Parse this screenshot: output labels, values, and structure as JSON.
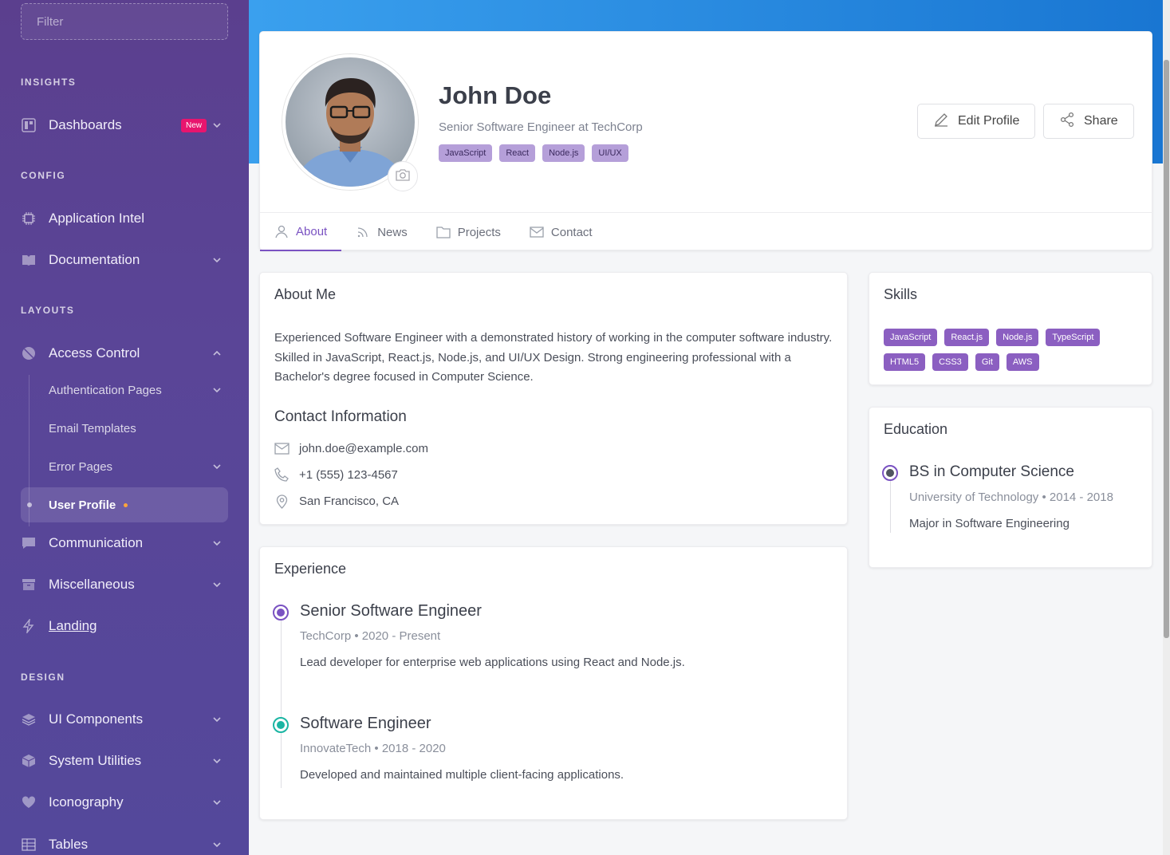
{
  "sidebar": {
    "filter_placeholder": "Filter",
    "sections": {
      "insights": "INSIGHTS",
      "config": "CONFIG",
      "layouts": "LAYOUTS",
      "design": "DESIGN"
    },
    "items": {
      "dashboards": "Dashboards",
      "dashboards_badge": "New",
      "application_intel": "Application Intel",
      "documentation": "Documentation",
      "access_control": "Access Control",
      "authentication_pages": "Authentication Pages",
      "email_templates": "Email Templates",
      "error_pages": "Error Pages",
      "user_profile": "User Profile",
      "communication": "Communication",
      "miscellaneous": "Miscellaneous",
      "landing": "Landing",
      "ui_components": "UI Components",
      "system_utilities": "System Utilities",
      "iconography": "Iconography",
      "tables": "Tables"
    }
  },
  "profile": {
    "name": "John Doe",
    "role": "Senior Software Engineer at TechCorp",
    "tags": [
      "JavaScript",
      "React",
      "Node.js",
      "UI/UX"
    ],
    "edit_label": "Edit Profile",
    "share_label": "Share"
  },
  "tabs": [
    "About",
    "News",
    "Projects",
    "Contact"
  ],
  "about": {
    "title": "About Me",
    "text": "Experienced Software Engineer with a demonstrated history of working in the computer software industry. Skilled in JavaScript, React.js, Node.js, and UI/UX Design. Strong engineering professional with a Bachelor's degree focused in Computer Science.",
    "contact_title": "Contact Information",
    "email": "john.doe@example.com",
    "phone": "+1 (555) 123-4567",
    "location": "San Francisco, CA"
  },
  "experience": {
    "title": "Experience",
    "jobs": [
      {
        "title": "Senior Software Engineer",
        "sub": "TechCorp • 2020 - Present",
        "desc": "Lead developer for enterprise web applications using React and Node.js.",
        "color": "#7a52c2"
      },
      {
        "title": "Software Engineer",
        "sub": "InnovateTech • 2018 - 2020",
        "desc": "Developed and maintained multiple client-facing applications.",
        "color": "#1bb5a3"
      }
    ]
  },
  "skills": {
    "title": "Skills",
    "list": [
      "JavaScript",
      "React.js",
      "Node.js",
      "TypeScript",
      "HTML5",
      "CSS3",
      "Git",
      "AWS"
    ]
  },
  "education": {
    "title": "Education",
    "degree": "BS in Computer Science",
    "school": "University of Technology • 2014 - 2018",
    "major": "Major in Software Engineering",
    "color": "#505560"
  }
}
